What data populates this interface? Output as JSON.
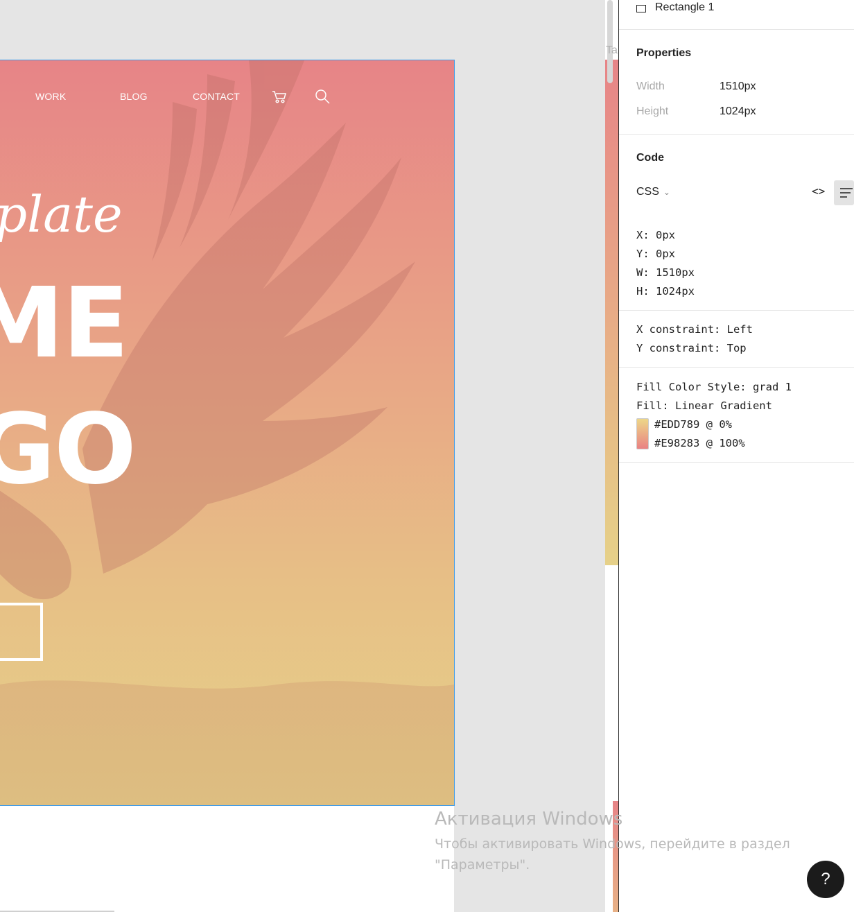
{
  "canvas": {
    "nav": {
      "work": "WORK",
      "blog": "BLOG",
      "contact": "CONTACT",
      "cart_icon": "cart-icon",
      "search_icon": "search-icon"
    },
    "script_text": "plate",
    "hero_line_1": "ME",
    "hero_line_2": "GO",
    "strip_partial_text": "Ta"
  },
  "panel": {
    "layer_name": "Rectangle 1",
    "properties_title": "Properties",
    "width_label": "Width",
    "width_value": "1510px",
    "height_label": "Height",
    "height_value": "1024px",
    "code_title": "Code",
    "language": "CSS",
    "code_lines": {
      "x": "X: 0px",
      "y": "Y: 0px",
      "w": "W: 1510px",
      "h": "H: 1024px",
      "x_constraint": "X constraint: Left",
      "y_constraint": "Y constraint: Top",
      "fill_style": "Fill Color Style: grad 1",
      "fill": "Fill: Linear Gradient"
    },
    "gradient_stops": [
      "#EDD789 @ 0%",
      "#E98283 @ 100%"
    ]
  },
  "watermark": {
    "title": "Активация Windows",
    "line1": "Чтобы активировать Windows, перейдите в раздел",
    "line2": "\"Параметры\"."
  },
  "help_button": "?",
  "colors": {
    "selection": "#3d9be9",
    "gradient_start": "#EDD789",
    "gradient_end": "#E98283"
  }
}
